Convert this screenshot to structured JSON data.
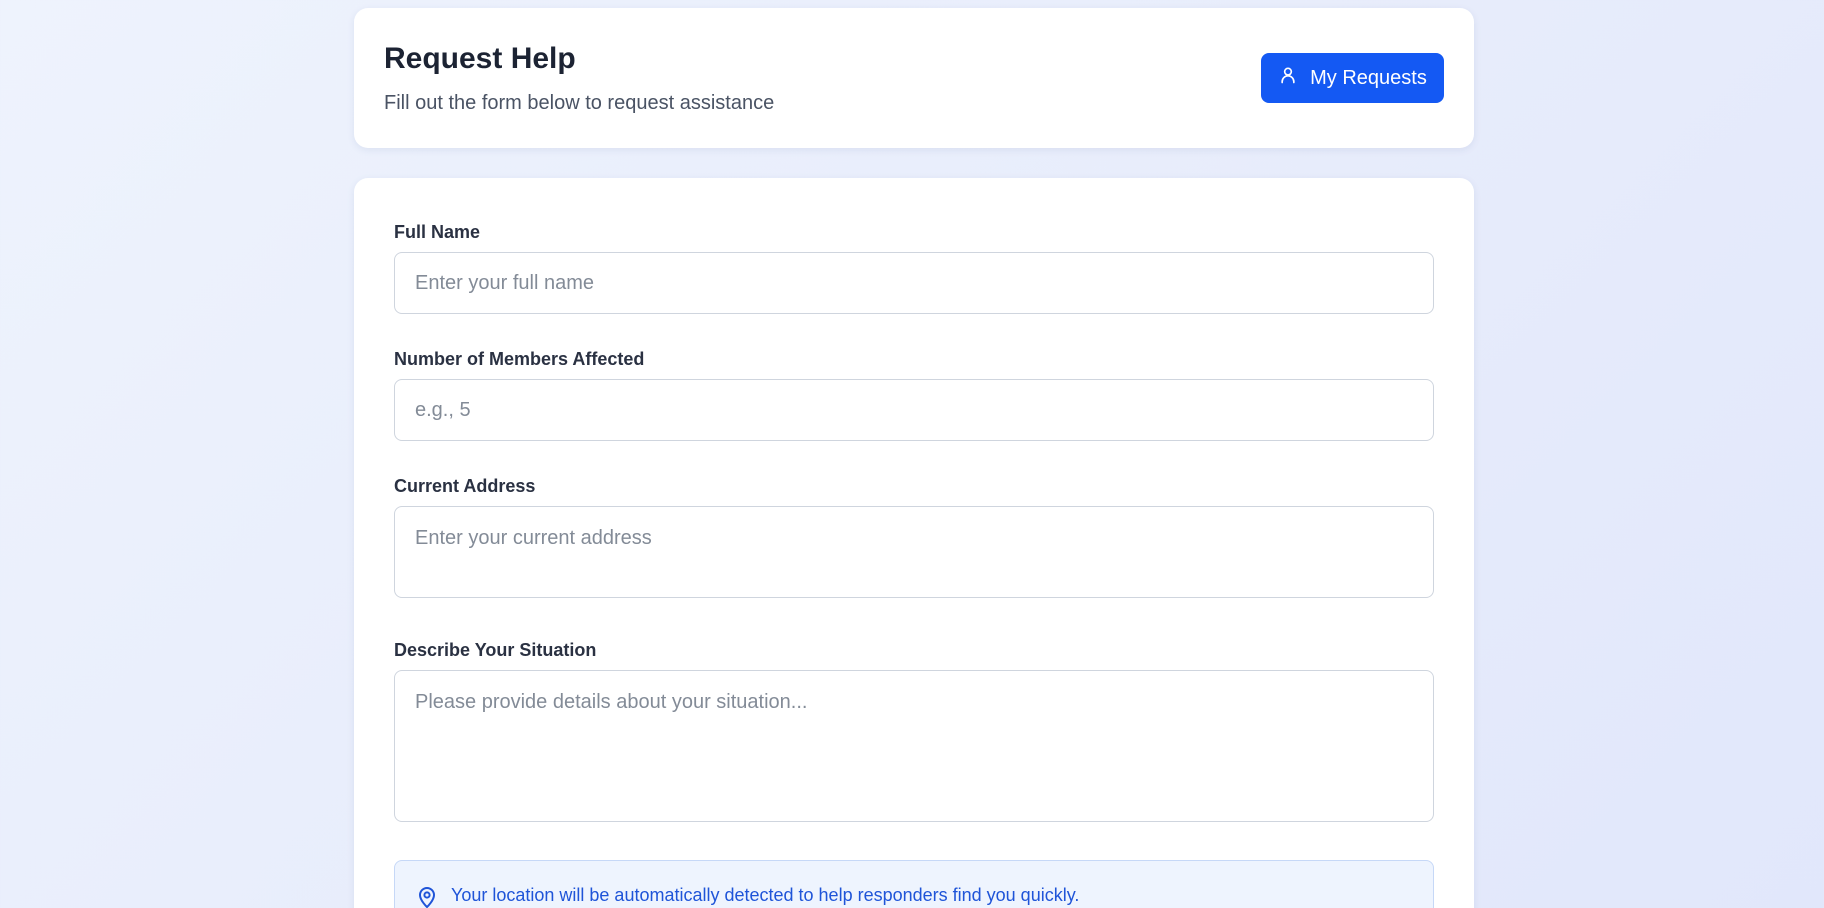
{
  "header": {
    "title": "Request Help",
    "subtitle": "Fill out the form below to request assistance",
    "my_requests_label": "My Requests",
    "my_requests_icon": "user-icon"
  },
  "form": {
    "full_name": {
      "label": "Full Name",
      "placeholder": "Enter your full name",
      "value": ""
    },
    "members": {
      "label": "Number of Members Affected",
      "placeholder": "e.g., 5",
      "value": ""
    },
    "address": {
      "label": "Current Address",
      "placeholder": "Enter your current address",
      "value": ""
    },
    "situation": {
      "label": "Describe Your Situation",
      "placeholder": "Please provide details about your situation...",
      "value": ""
    },
    "location_note": {
      "icon": "map-pin-icon",
      "text": "Your location will be automatically detected to help responders find you quickly."
    }
  },
  "colors": {
    "accent": "#1459f3",
    "info_text": "#1f54d8",
    "info_bg": "#eef4fe"
  }
}
